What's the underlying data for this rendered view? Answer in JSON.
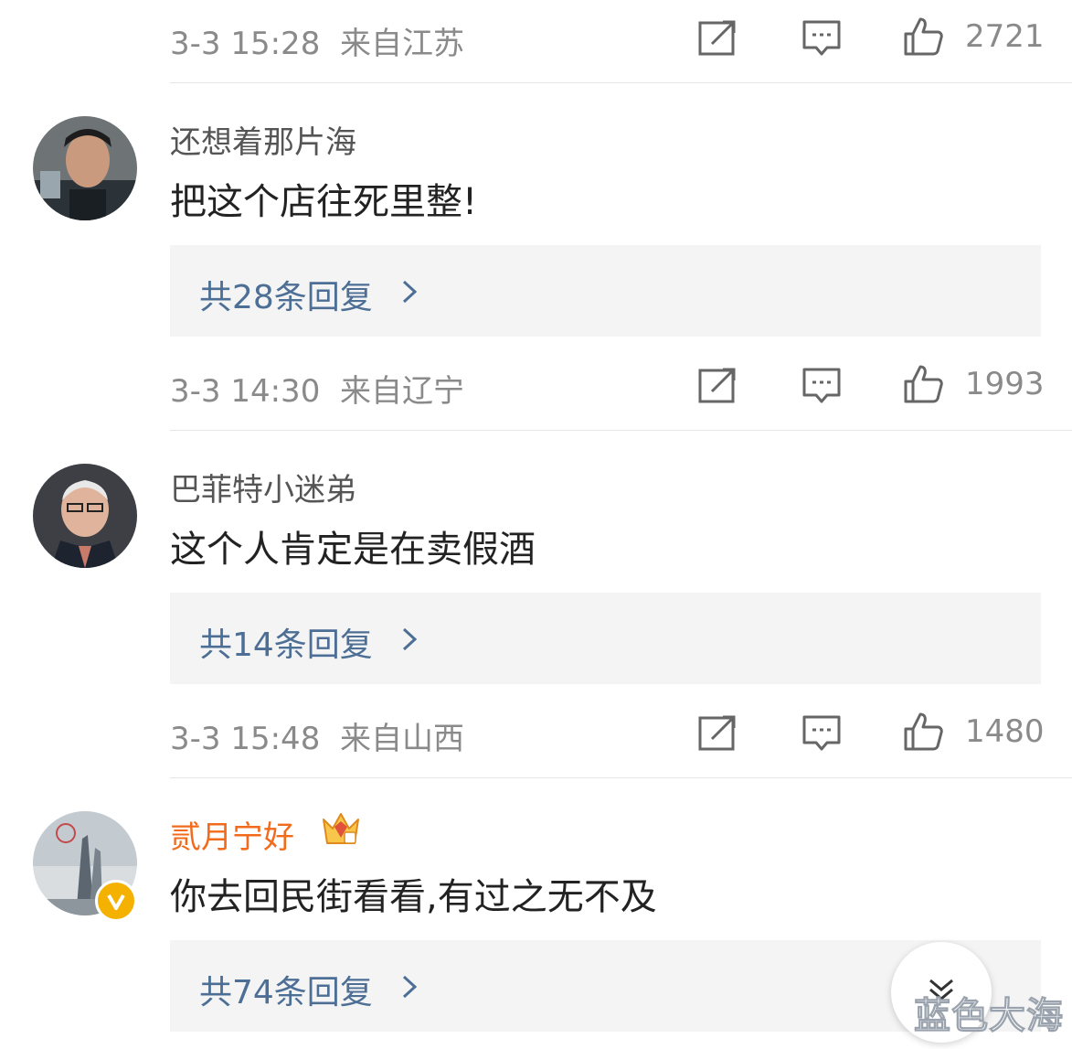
{
  "comments_top": {
    "meta": {
      "datetime": "3-3 15:28",
      "location": "来自江苏",
      "likes": "2721"
    }
  },
  "comments": [
    {
      "username": "还想着那片海",
      "text": "把这个店往死里整!",
      "reply_summary": "共28条回复",
      "meta": {
        "datetime": "3-3 14:30",
        "location": "来自辽宁",
        "likes": "1993"
      }
    },
    {
      "username": "巴菲特小迷弟",
      "text": "这个人肯定是在卖假酒",
      "reply_summary": "共14条回复",
      "meta": {
        "datetime": "3-3 15:48",
        "location": "来自山西",
        "likes": "1480"
      }
    },
    {
      "username": "贰月宁好",
      "text": "你去回民街看看,有过之无不及",
      "reply_summary": "共74条回复"
    }
  ],
  "icons": {
    "share": "share-icon",
    "comment": "comment-icon",
    "like": "thumbs-up-icon",
    "reply_arrow": "chevron-right-icon",
    "scroll": "double-chevron-down-icon",
    "vip": "crown-icon",
    "verified": "verified-v-icon"
  },
  "colors": {
    "reply_link": "#4d6f95",
    "vip_name": "#f26b1d",
    "meta_text": "#8a8a8a"
  },
  "watermark": "蓝色大海"
}
